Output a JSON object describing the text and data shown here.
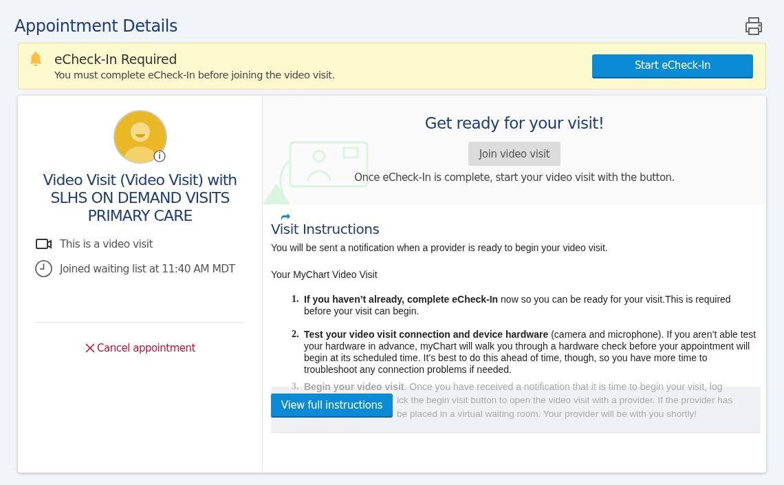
{
  "page": {
    "title": "Appointment Details"
  },
  "banner": {
    "title": "eCheck-In Required",
    "message": "You must complete eCheck-In before joining the video visit.",
    "button": "Start eCheck-In"
  },
  "appointment": {
    "title": "Video Visit (Video Visit) with SLHS ON DEMAND VISITS PRIMARY CARE",
    "cancel": "Cancel appointment",
    "details": [
      {
        "kind": "video",
        "text": "This is a video visit"
      },
      {
        "kind": "time",
        "text": "Joined waiting list at 11:40 AM MDT"
      }
    ]
  },
  "ready": {
    "heading": "Get ready for your visit!",
    "button": {
      "label": "Join video visit",
      "disabled": true
    },
    "note": "Once eCheck-In is complete, start your video visit with the button."
  },
  "instructions": {
    "heading": "Visit Instructions",
    "intro": "You will be sent a notification when a provider is ready to begin your video visit.",
    "subheading": "Your MyChart Video Visit",
    "steps": [
      {
        "number": "1.",
        "text": "**If you haven’t already, complete eCheck-In** now so you can be ready for your visit.This is required before your visit can begin."
      },
      {
        "number": "2.",
        "text": "**Test your video visit connection and device hardware** (camera and microphone). If you aren’t able test your hardware in advance, myChart will walk you through a hardware check before your appointment will begin at its scheduled time. It’s best to do this ahead of time, though, so you have more time to troubleshoot any connection problems if needed."
      }
    ],
    "faded_step": {
      "number": "3.",
      "text": "**Begin your video visit**. Once you have received a notification that it is time to begin your visit, log",
      "fragments": [
        "ick the begin visit button to open the video visit with a provider. If the provider has",
        "be placed in a virtual waiting room. Your provider will be with you shortly!"
      ]
    },
    "button": "View full instructions"
  }
}
